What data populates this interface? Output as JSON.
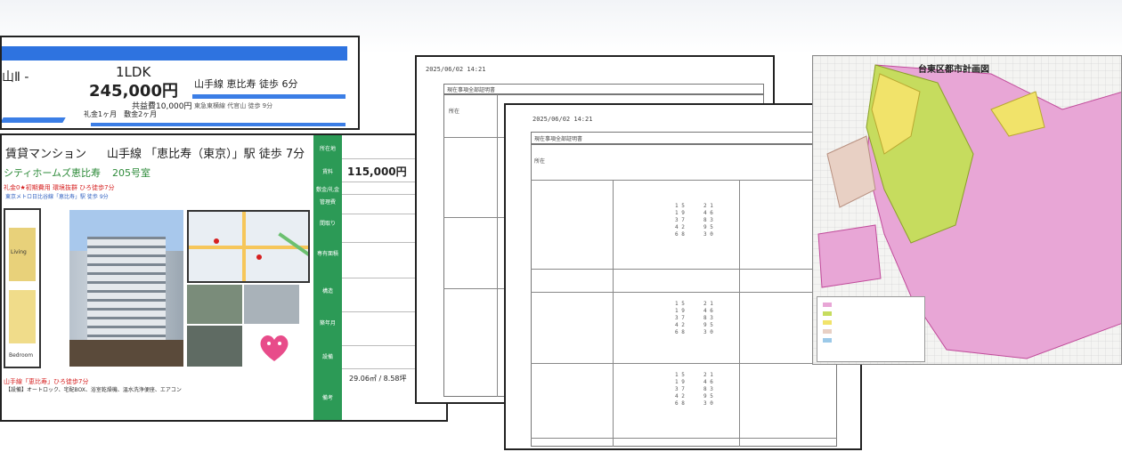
{
  "flyer_top": {
    "title": "山Ⅱ -",
    "layout": "1LDK",
    "price": "245,000円",
    "station": "山手線 恵比寿 徒歩 6分",
    "common_fee": "共益費10,000円",
    "deposit": "礼金1ヶ月　敷金2ヶ月",
    "small_text": "東急東横線 代官山 徒歩 9分"
  },
  "flyer_main": {
    "building_type": "賃貸マンション",
    "line_station": "山手線 「恵比寿（東京）」駅 徒歩 7分",
    "apartment_name": "シティホームズ恵比寿",
    "unit": "205号室",
    "promo_red": "礼金0★初期費用 環境抜群 ひろ徒歩7分",
    "info_blue": "東京メトロ日比谷線「恵比寿」駅 徒歩 9分",
    "rent": "115,000円",
    "area": "29.06㎡ / 8.58坪",
    "bottom_red": "山手線「恵比寿」ひろ徒歩7分",
    "bottom_text": "【設備】オートロック、宅配BOX、浴室乾燥機、温水洗浄便座、エアコン",
    "floorplan_labels": [
      "Living",
      "Bedroom"
    ],
    "sidebar_labels": [
      "所在地",
      "賃料",
      "敷金/礼金",
      "管理費",
      "間取り",
      "専有面積",
      "構造",
      "築年月",
      "設備",
      "備考"
    ]
  },
  "doc_back": {
    "datetime": "2025/06/02 14:21",
    "header": "現在事項全部証明書",
    "row_label": "所在"
  },
  "doc_front": {
    "datetime": "2025/06/02 14:21",
    "header": "現在事項全部証明書",
    "row_label": "所在",
    "col_a": "1 5\n1 9\n3 7\n4 2\n6 8",
    "col_b": "2 1\n4 6\n8 3\n9 5\n3 0"
  },
  "planning_map": {
    "title": "台東区都市計画図",
    "colors": {
      "residential": "#e8a6d6",
      "commercial": "#c6dc5e",
      "industrial": "#f1e36a",
      "base": "#f4f4f2"
    }
  }
}
